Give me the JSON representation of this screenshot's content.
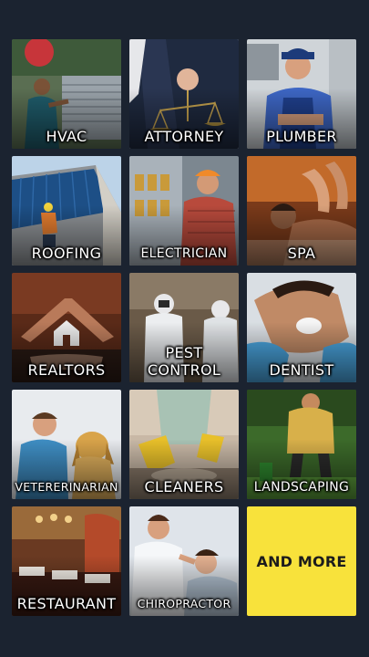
{
  "tiles": [
    {
      "id": "hvac",
      "label": "HVAC"
    },
    {
      "id": "attorney",
      "label": "ATTORNEY"
    },
    {
      "id": "plumber",
      "label": "PLUMBER"
    },
    {
      "id": "roofing",
      "label": "ROOFING"
    },
    {
      "id": "electrician",
      "label": "ELECTRICIAN"
    },
    {
      "id": "spa",
      "label": "SPA"
    },
    {
      "id": "realtors",
      "label": "REALTORS"
    },
    {
      "id": "pest-control",
      "label": "PEST CONTROL",
      "line1": "PEST",
      "line2": "CONTROL"
    },
    {
      "id": "dentist",
      "label": "DENTIST"
    },
    {
      "id": "veterinarian",
      "label": "VETERERINARIAN"
    },
    {
      "id": "cleaners",
      "label": "CLEANERS"
    },
    {
      "id": "landscaping",
      "label": "LANDSCAPING"
    },
    {
      "id": "restaurant",
      "label": "RESTAURANT"
    },
    {
      "id": "chiropractor",
      "label": "CHIROPRACTOR"
    },
    {
      "id": "and-more",
      "label": "AND MORE"
    }
  ],
  "colors": {
    "background": "#1b2330",
    "more_tile": "#f8e23b",
    "label_text": "#ffffff",
    "more_text": "#1c1c1c"
  }
}
